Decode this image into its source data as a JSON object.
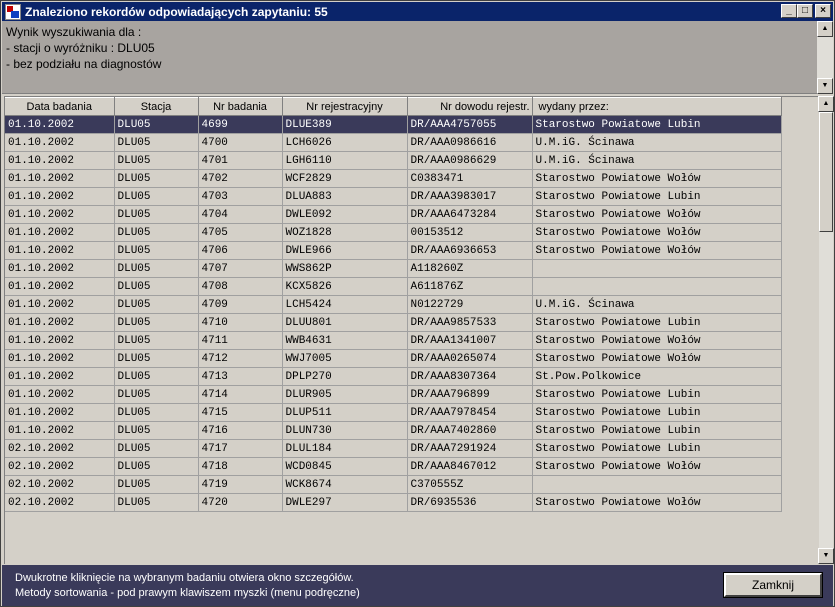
{
  "window": {
    "title": "Znaleziono rekordów odpowiadających zapytaniu: 55",
    "minimize_label": "_",
    "maximize_label": "□",
    "close_label": "×"
  },
  "info": {
    "line1": "Wynik wyszukiwania dla :",
    "line2": "- stacji o wyróżniku : DLU05",
    "line3": "- bez podziału na diagnostów"
  },
  "scroll": {
    "up": "▲",
    "down": "▼"
  },
  "table": {
    "headers": [
      "Data badania",
      "Stacja",
      "Nr badania",
      "Nr rejestracyjny",
      "Nr dowodu rejestr.",
      "wydany przez:"
    ],
    "rows": [
      [
        "01.10.2002",
        "DLU05",
        "4699",
        "DLUE389",
        "DR/AAA4757055",
        "Starostwo Powiatowe Lubin"
      ],
      [
        "01.10.2002",
        "DLU05",
        "4700",
        "LCH6026",
        "DR/AAA0986616",
        "U.M.iG. Ścinawa"
      ],
      [
        "01.10.2002",
        "DLU05",
        "4701",
        "LGH6110",
        "DR/AAA0986629",
        "U.M.iG. Ścinawa"
      ],
      [
        "01.10.2002",
        "DLU05",
        "4702",
        "WCF2829",
        "C0383471",
        "Starostwo Powiatowe Wołów"
      ],
      [
        "01.10.2002",
        "DLU05",
        "4703",
        "DLUA883",
        "DR/AAA3983017",
        "Starostwo Powiatowe Lubin"
      ],
      [
        "01.10.2002",
        "DLU05",
        "4704",
        "DWLE092",
        "DR/AAA6473284",
        "Starostwo Powiatowe Wołów"
      ],
      [
        "01.10.2002",
        "DLU05",
        "4705",
        "WOZ1828",
        "00153512",
        "Starostwo Powiatowe Wołów"
      ],
      [
        "01.10.2002",
        "DLU05",
        "4706",
        "DWLE966",
        "DR/AAA6936653",
        "Starostwo Powiatowe Wołów"
      ],
      [
        "01.10.2002",
        "DLU05",
        "4707",
        "WWS862P",
        "A118260Z",
        ""
      ],
      [
        "01.10.2002",
        "DLU05",
        "4708",
        "KCX5826",
        "A611876Z",
        ""
      ],
      [
        "01.10.2002",
        "DLU05",
        "4709",
        "LCH5424",
        "N0122729",
        "U.M.iG. Ścinawa"
      ],
      [
        "01.10.2002",
        "DLU05",
        "4710",
        "DLUU801",
        "DR/AAA9857533",
        "Starostwo Powiatowe Lubin"
      ],
      [
        "01.10.2002",
        "DLU05",
        "4711",
        "WWB4631",
        "DR/AAA1341007",
        "Starostwo Powiatowe Wołów"
      ],
      [
        "01.10.2002",
        "DLU05",
        "4712",
        "WWJ7005",
        "DR/AAA0265074",
        "Starostwo Powiatowe Wołów"
      ],
      [
        "01.10.2002",
        "DLU05",
        "4713",
        "DPLP270",
        "DR/AAA8307364",
        "St.Pow.Polkowice"
      ],
      [
        "01.10.2002",
        "DLU05",
        "4714",
        "DLUR905",
        "DR/AAA796899",
        "Starostwo Powiatowe Lubin"
      ],
      [
        "01.10.2002",
        "DLU05",
        "4715",
        "DLUP511",
        "DR/AAA7978454",
        "Starostwo Powiatowe Lubin"
      ],
      [
        "01.10.2002",
        "DLU05",
        "4716",
        "DLUN730",
        "DR/AAA7402860",
        "Starostwo Powiatowe Lubin"
      ],
      [
        "02.10.2002",
        "DLU05",
        "4717",
        "DLUL184",
        "DR/AAA7291924",
        "Starostwo Powiatowe Lubin"
      ],
      [
        "02.10.2002",
        "DLU05",
        "4718",
        "WCD0845",
        "DR/AAA8467012",
        "Starostwo Powiatowe Wołów"
      ],
      [
        "02.10.2002",
        "DLU05",
        "4719",
        "WCK8674",
        "C370555Z",
        ""
      ],
      [
        "02.10.2002",
        "DLU05",
        "4720",
        "DWLE297",
        "DR/6935536",
        "Starostwo Powiatowe Wołów"
      ]
    ]
  },
  "status": {
    "line1": "Dwukrotne kliknięcie na wybranym badaniu otwiera okno szczegółów.",
    "line2": "Metody sortowania - pod prawym klawiszem myszki (menu podręczne)"
  },
  "buttons": {
    "close_label": "Zamknij"
  },
  "colors": {
    "titlebar": "#0a246a",
    "selected_row": "#3a3a5a",
    "status_bar": "#3a3a5a"
  }
}
